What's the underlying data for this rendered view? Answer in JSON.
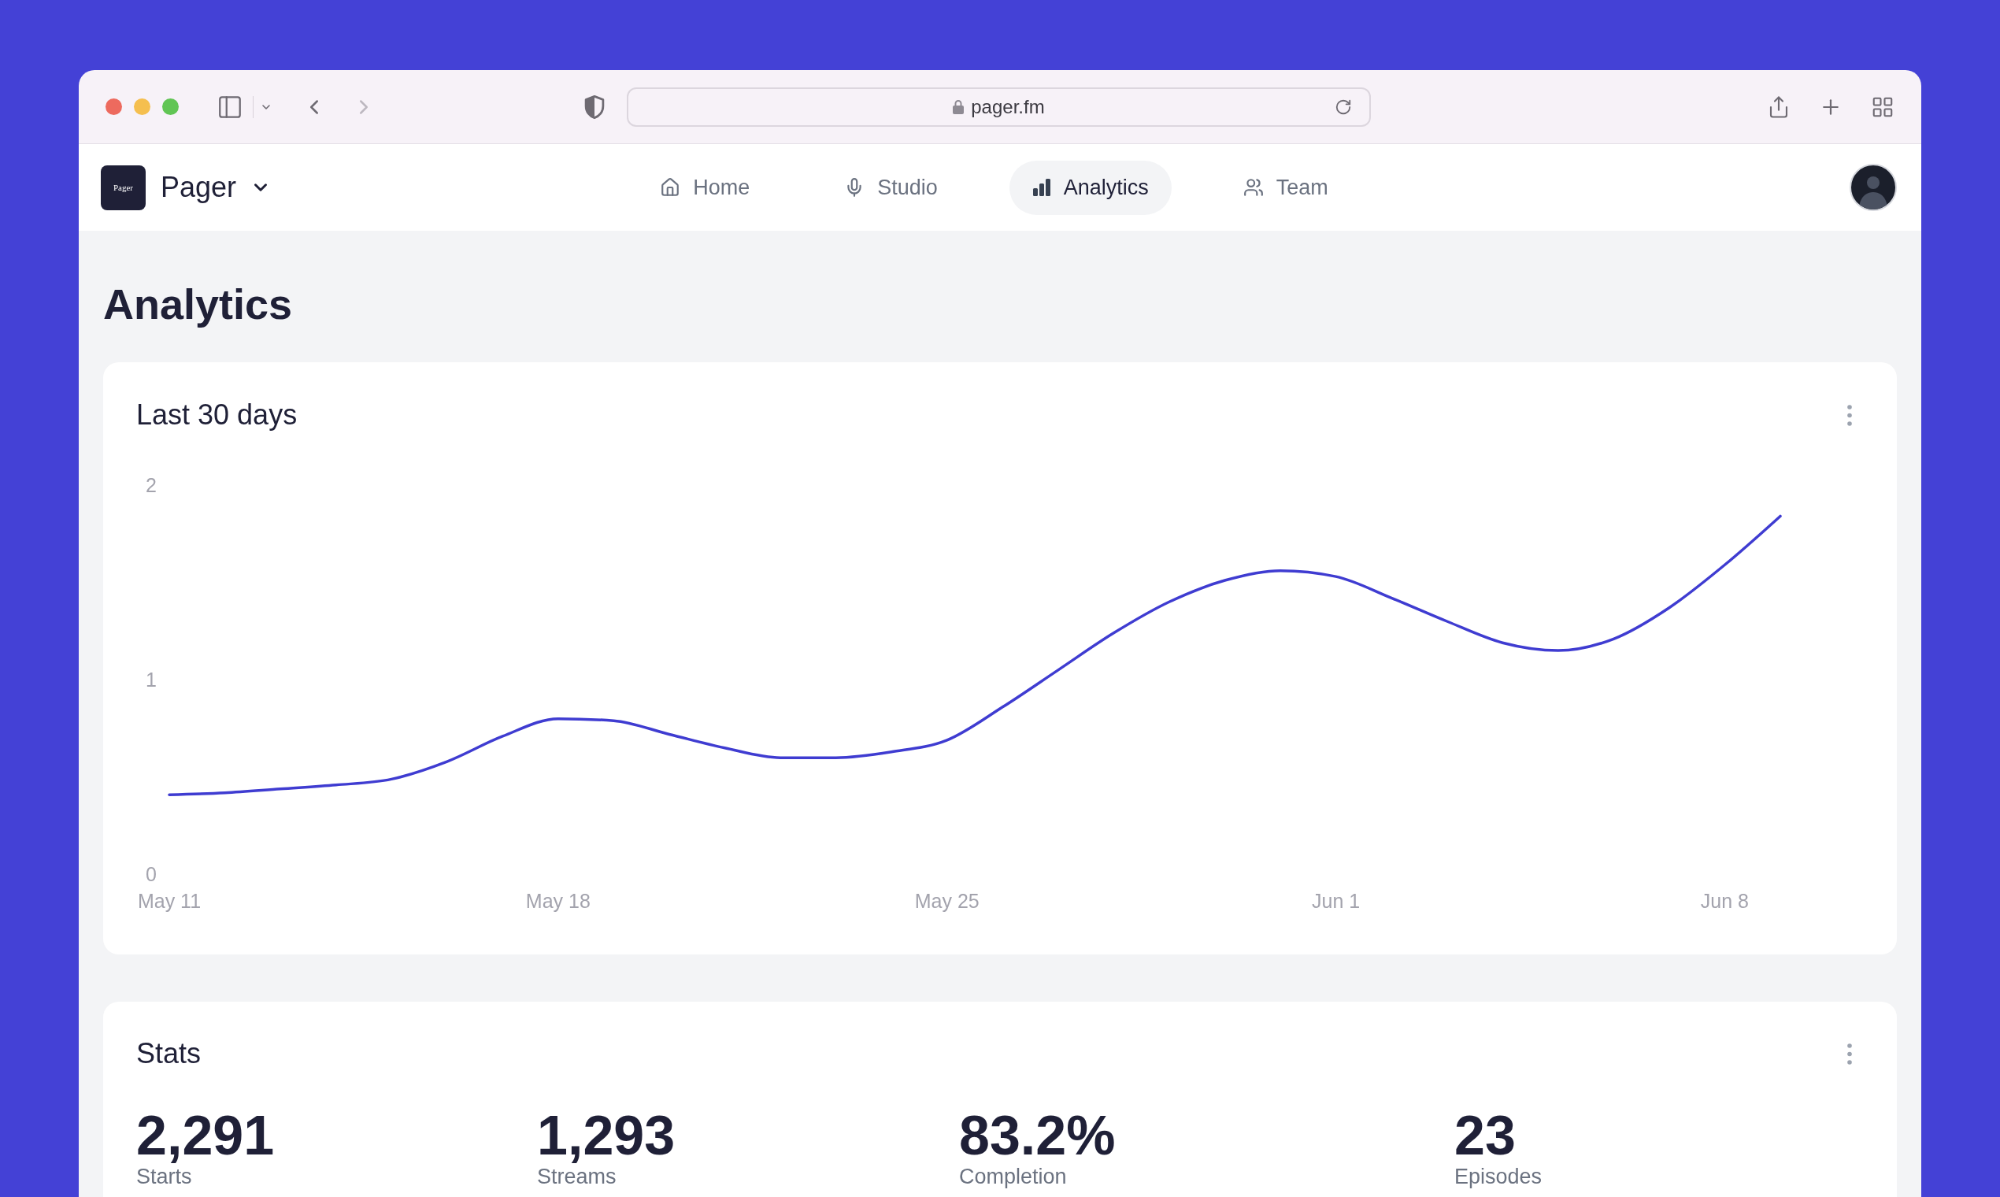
{
  "browser": {
    "address": "pager.fm",
    "can_go_forward": false
  },
  "header": {
    "logo_text": "Pager",
    "workspace": "Pager",
    "nav": [
      {
        "label": "Home",
        "selected": false
      },
      {
        "label": "Studio",
        "selected": false
      },
      {
        "label": "Analytics",
        "selected": true
      },
      {
        "label": "Team",
        "selected": false
      }
    ]
  },
  "page": {
    "title": "Analytics"
  },
  "chart_card": {
    "title": "Last 30 days",
    "chart_data": {
      "type": "line",
      "categories": [
        "May 11",
        null,
        null,
        null,
        null,
        null,
        null,
        "May 18",
        null,
        null,
        null,
        null,
        null,
        null,
        "May 25",
        null,
        null,
        null,
        null,
        null,
        null,
        "Jun 1",
        null,
        null,
        null,
        null,
        null,
        null,
        "Jun 8",
        null
      ],
      "ylim": [
        -0.41,
        2.63
      ],
      "yticks": [
        0,
        1,
        2
      ],
      "series": [
        {
          "color": "#3f3cd1",
          "values": [
            0.41,
            0.42,
            0.44,
            0.46,
            0.49,
            0.58,
            0.71,
            0.8,
            0.79,
            0.72,
            0.65,
            0.6,
            0.6,
            0.63,
            0.69,
            0.86,
            1.05,
            1.24,
            1.4,
            1.51,
            1.56,
            1.53,
            1.42,
            1.3,
            1.19,
            1.15,
            1.21,
            1.37,
            1.59,
            1.84
          ]
        }
      ]
    }
  },
  "stats_card": {
    "title": "Stats",
    "stats": [
      {
        "value": "2,291",
        "label": "Starts"
      },
      {
        "value": "1,293",
        "label": "Streams"
      },
      {
        "value": "83.2%",
        "label": "Completion"
      },
      {
        "value": "23",
        "label": "Episodes"
      }
    ]
  }
}
